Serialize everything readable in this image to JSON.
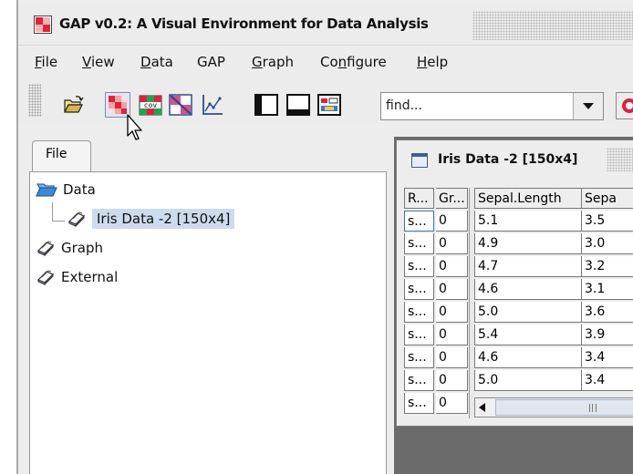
{
  "window": {
    "title": "GAP v0.2: A Visual Environment for Data Analysis",
    "icon": "gap-app-icon"
  },
  "menubar": [
    {
      "key": "F",
      "rest": "ile"
    },
    {
      "key": "V",
      "rest": "iew"
    },
    {
      "key": "D",
      "rest": "ata"
    },
    {
      "key": "",
      "rest": "GAP"
    },
    {
      "key": "G",
      "rest": "raph"
    },
    {
      "pre": "Co",
      "key": "n",
      "rest": "figure"
    },
    {
      "key": "H",
      "rest": "elp"
    }
  ],
  "toolbar": {
    "buttons": [
      "open-folder",
      "heatmap-matrix",
      "covariance-matrix",
      "proximity-matrix",
      "line-chart",
      "layout-left",
      "layout-bottom",
      "layout-config"
    ],
    "cov_label": "cov",
    "find_placeholder": "find..."
  },
  "left_panel": {
    "tab": "File",
    "tree": {
      "data": "Data",
      "iris": "Iris Data -2 [150x4]",
      "graph": "Graph",
      "external": "External"
    }
  },
  "data_window": {
    "title": "Iris Data -2 [150x4]",
    "columns": [
      "R...",
      "Gr...",
      "Sepal.Length",
      "Sepa"
    ],
    "rows": [
      [
        "s...",
        "0",
        "5.1",
        "3.5"
      ],
      [
        "s...",
        "0",
        "4.9",
        "3.0"
      ],
      [
        "s...",
        "0",
        "4.7",
        "3.2"
      ],
      [
        "s...",
        "0",
        "4.6",
        "3.1"
      ],
      [
        "s...",
        "0",
        "5.0",
        "3.6"
      ],
      [
        "s...",
        "0",
        "5.4",
        "3.9"
      ],
      [
        "s...",
        "0",
        "4.6",
        "3.4"
      ],
      [
        "s...",
        "0",
        "5.0",
        "3.4"
      ],
      [
        "s...",
        "0",
        "",
        ""
      ]
    ]
  },
  "colors": {
    "selection": "#cddbee",
    "accent": "#e04a4a",
    "folder": "#2a7fd0"
  }
}
